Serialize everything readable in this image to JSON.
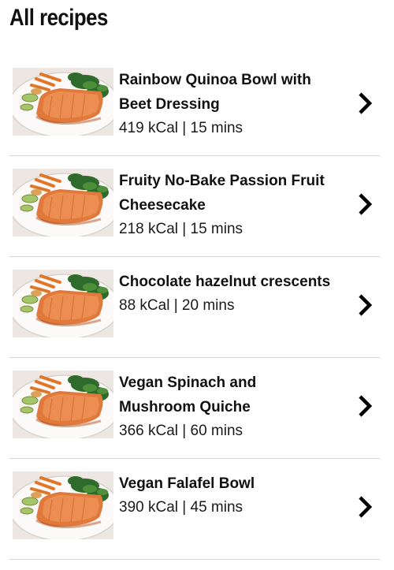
{
  "header": {
    "title": "All recipes"
  },
  "recipes": [
    {
      "name": "Rainbow Quinoa Bowl with Beet Dressing",
      "kcal": "419 kCal",
      "separator": "|",
      "time": "15 mins"
    },
    {
      "name": "Fruity No-Bake Passion Fruit Cheesecake",
      "kcal": "218 kCal",
      "separator": "|",
      "time": "15 mins"
    },
    {
      "name": "Chocolate hazelnut crescents",
      "kcal": "88 kCal",
      "separator": "|",
      "time": "20 mins"
    },
    {
      "name": "Vegan Spinach and Mushroom Quiche",
      "kcal": "366 kCal",
      "separator": "|",
      "time": "60 mins"
    },
    {
      "name": "Vegan Falafel Bowl",
      "kcal": "390 kCal",
      "separator": "|",
      "time": "45 mins"
    }
  ],
  "icons": {
    "row_arrow": "chevron-right-icon",
    "thumbnail": "salmon-plate-image"
  },
  "colors": {
    "divider": "#d6d6d6",
    "text": "#111111",
    "background": "#ffffff"
  }
}
